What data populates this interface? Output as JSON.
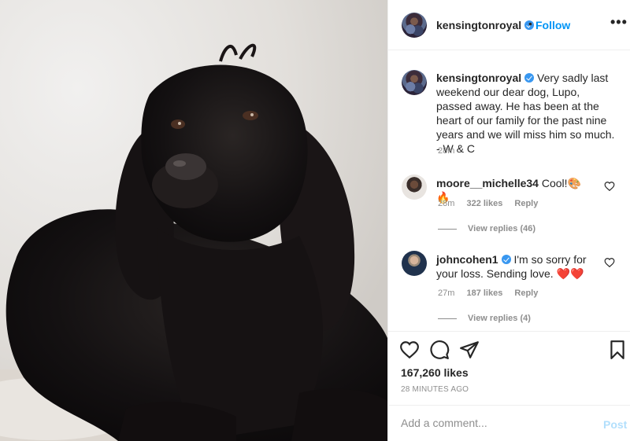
{
  "post": {
    "username": "kensingtonroyal",
    "follow_label": "Follow",
    "separator": "•",
    "more_label": "•••",
    "caption": "Very sadly last weekend our dear dog, Lupo, passed away. He has been at the heart of our family for the past nine years and we will miss him so much. - W & C",
    "caption_time": "28m",
    "likes": "167,260 likes",
    "time_ago": "28 MINUTES AGO"
  },
  "comments": [
    {
      "username": "moore__michelle34",
      "text": "Cool!",
      "emoji": "🎨🔥",
      "time": "28m",
      "likes": "322 likes",
      "reply_label": "Reply",
      "view_replies": "View replies (46)"
    },
    {
      "username": "johncohen1",
      "text": "I'm so sorry for your loss. Sending love.",
      "emoji": "❤️❤️",
      "time": "27m",
      "likes": "187 likes",
      "reply_label": "Reply",
      "view_replies": "View replies (4)"
    }
  ],
  "add_comment": {
    "placeholder": "Add a comment...",
    "post_label": "Post"
  },
  "colors": {
    "accent": "#0095f6",
    "verified": "#3897f0",
    "muted": "#8e8e8e",
    "post_disabled": "#b2dffc"
  }
}
